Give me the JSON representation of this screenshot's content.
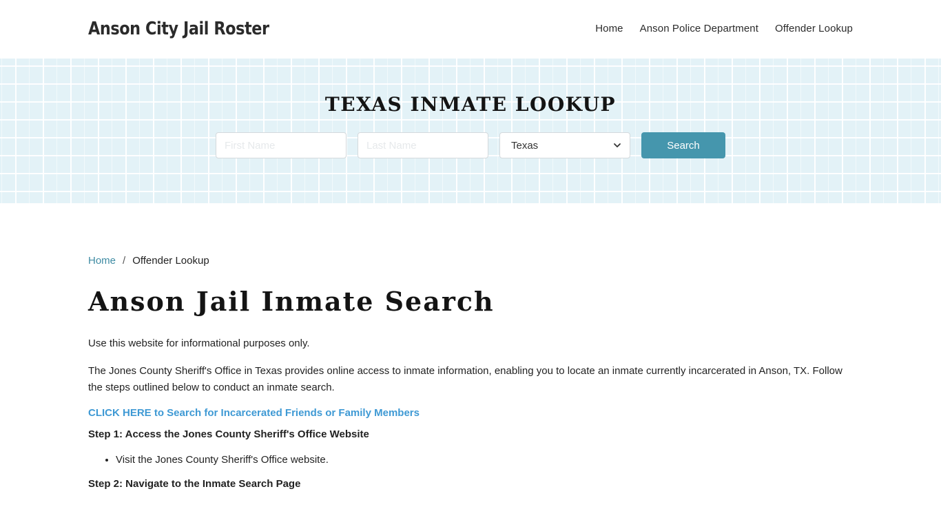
{
  "header": {
    "brand": "Anson City Jail Roster",
    "nav": [
      {
        "label": "Home"
      },
      {
        "label": "Anson Police Department"
      },
      {
        "label": "Offender Lookup"
      }
    ]
  },
  "banner": {
    "title": "TEXAS INMATE LOOKUP",
    "first_name_placeholder": "First Name",
    "last_name_placeholder": "Last Name",
    "state_selected": "Texas",
    "search_label": "Search",
    "colors": {
      "background": "#e3f2f7",
      "button": "#4596ad"
    }
  },
  "breadcrumb": {
    "home": "Home",
    "separator": "/",
    "current": "Offender Lookup"
  },
  "main": {
    "title": "Anson Jail Inmate Search",
    "intro": "Use this website for informational purposes only.",
    "description": "The Jones County Sheriff's Office in Texas provides online access to inmate information, enabling you to locate an inmate currently incarcerated in Anson, TX. Follow the steps outlined below to conduct an inmate search.",
    "cta_link": "CLICK HERE to Search for Incarcerated Friends or Family Members",
    "steps": [
      {
        "heading": "Step 1: Access the Jones County Sheriff's Office Website",
        "items": [
          "Visit the Jones County Sheriff's Office website."
        ]
      },
      {
        "heading": "Step 2: Navigate to the Inmate Search Page",
        "items": []
      }
    ],
    "link_color": "#3e99d4"
  }
}
